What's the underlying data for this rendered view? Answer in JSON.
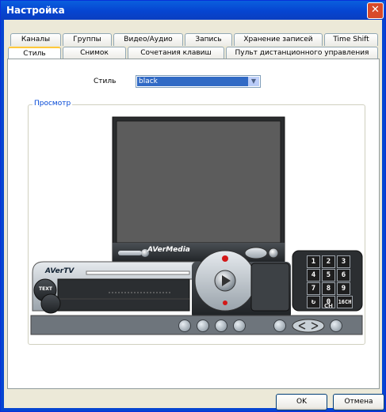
{
  "window": {
    "title": "Настройка",
    "close_glyph": "✕"
  },
  "tabs_row1": [
    {
      "label": "Каналы"
    },
    {
      "label": "Группы"
    },
    {
      "label": "Видео/Аудио"
    },
    {
      "label": "Запись"
    },
    {
      "label": "Хранение записей"
    },
    {
      "label": "Time Shift"
    }
  ],
  "tabs_row2": [
    {
      "label": "Стиль",
      "active": true
    },
    {
      "label": "Снимок"
    },
    {
      "label": "Сочетания клавиш"
    },
    {
      "label": "Пульт дистанционного управления"
    }
  ],
  "style": {
    "label": "Стиль",
    "selected": "black"
  },
  "preview": {
    "label": "Просмотр",
    "brand": "AVerMedia",
    "product": "AVerTV",
    "keypad": [
      "1",
      "2",
      "3",
      "4",
      "5",
      "6",
      "7",
      "8",
      "9",
      "0",
      "16CH"
    ],
    "ch_label": "CH",
    "text_label": "TEXT"
  },
  "buttons": {
    "ok": "OK",
    "cancel": "Отмена"
  },
  "colors": {
    "accent": "#0645d1",
    "selection": "#316ac5",
    "skin_dark": "#2b2e31",
    "skin_light": "#b9c1c8",
    "record": "#d31818"
  }
}
